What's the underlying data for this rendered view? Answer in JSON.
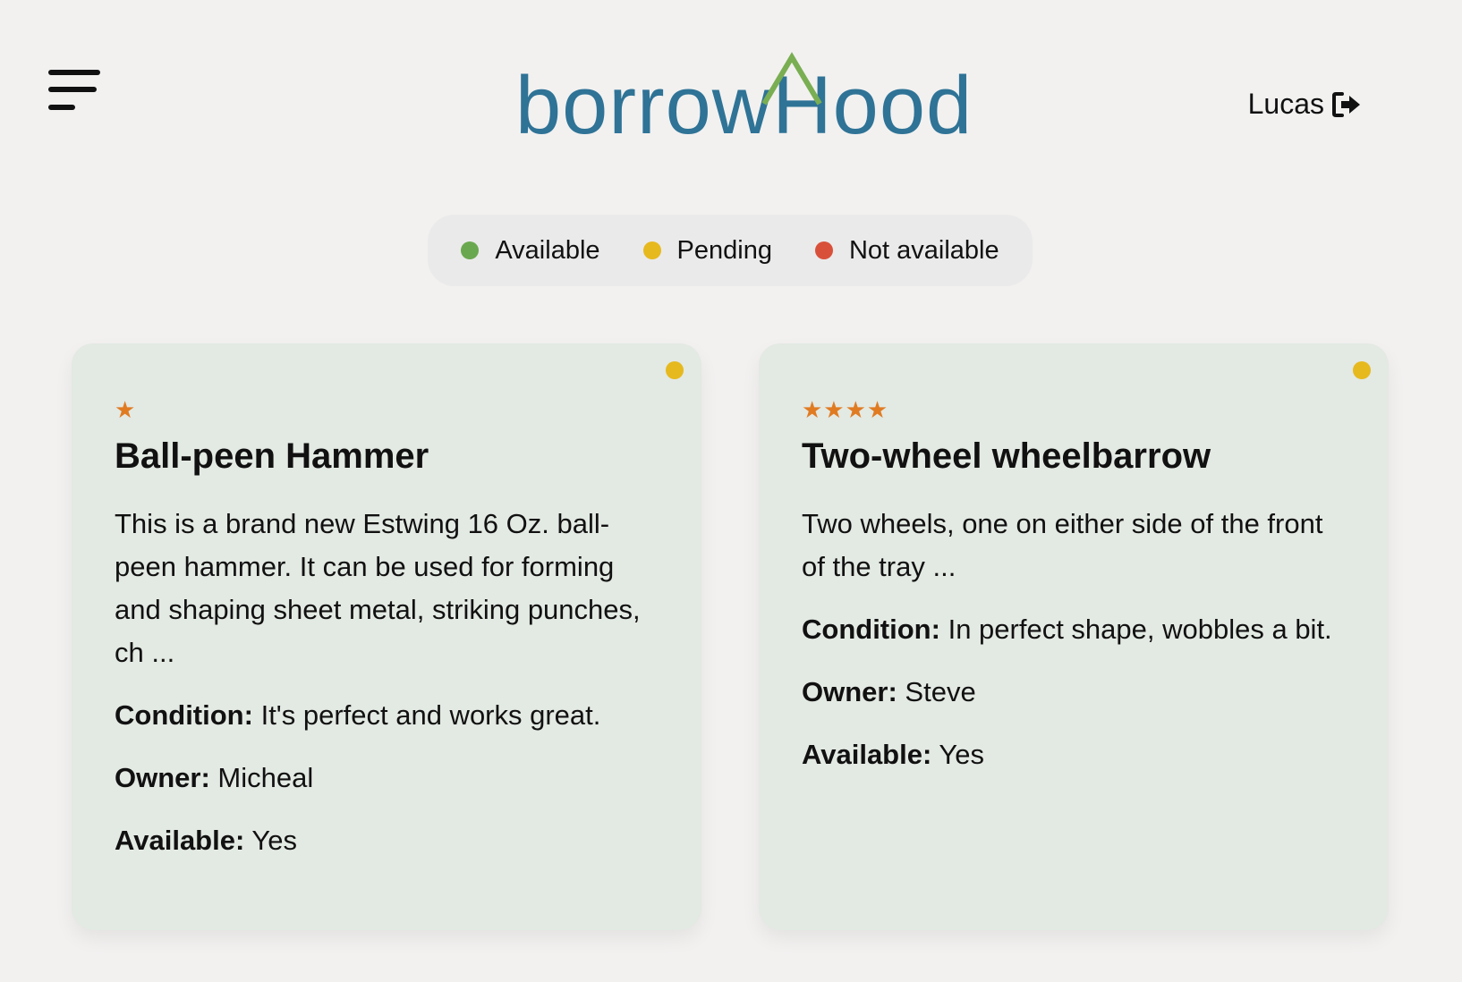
{
  "header": {
    "logo_text": "borrowHood",
    "user_name": "Lucas"
  },
  "legend": [
    {
      "label": "Available",
      "color": "#6aa84f"
    },
    {
      "label": "Pending",
      "color": "#e6b91e"
    },
    {
      "label": "Not available",
      "color": "#d9503a"
    }
  ],
  "items": [
    {
      "stars": "★",
      "rating": 1,
      "title": "Ball-peen Hammer",
      "description": "This is a brand new Estwing 16 Oz. ball-peen hammer. It can be used for forming and shaping sheet metal, striking punches, ch ...",
      "condition_label": "Condition:",
      "condition": "It's perfect and works great.",
      "owner_label": "Owner:",
      "owner": "Micheal",
      "available_label": "Available:",
      "available": "Yes",
      "status_color": "#e6b91e"
    },
    {
      "stars": "★★★★",
      "rating": 4,
      "title": "Two-wheel wheelbarrow",
      "description": "Two wheels, one on either side of the front of the tray ...",
      "condition_label": "Condition:",
      "condition": "In perfect shape, wobbles a bit.",
      "owner_label": "Owner:",
      "owner": "Steve",
      "available_label": "Available:",
      "available": "Yes",
      "status_color": "#e6b91e"
    }
  ],
  "icons": {
    "menu": "hamburger-menu-icon",
    "logout": "logout-icon",
    "logo_roof": "house-roof-icon"
  }
}
